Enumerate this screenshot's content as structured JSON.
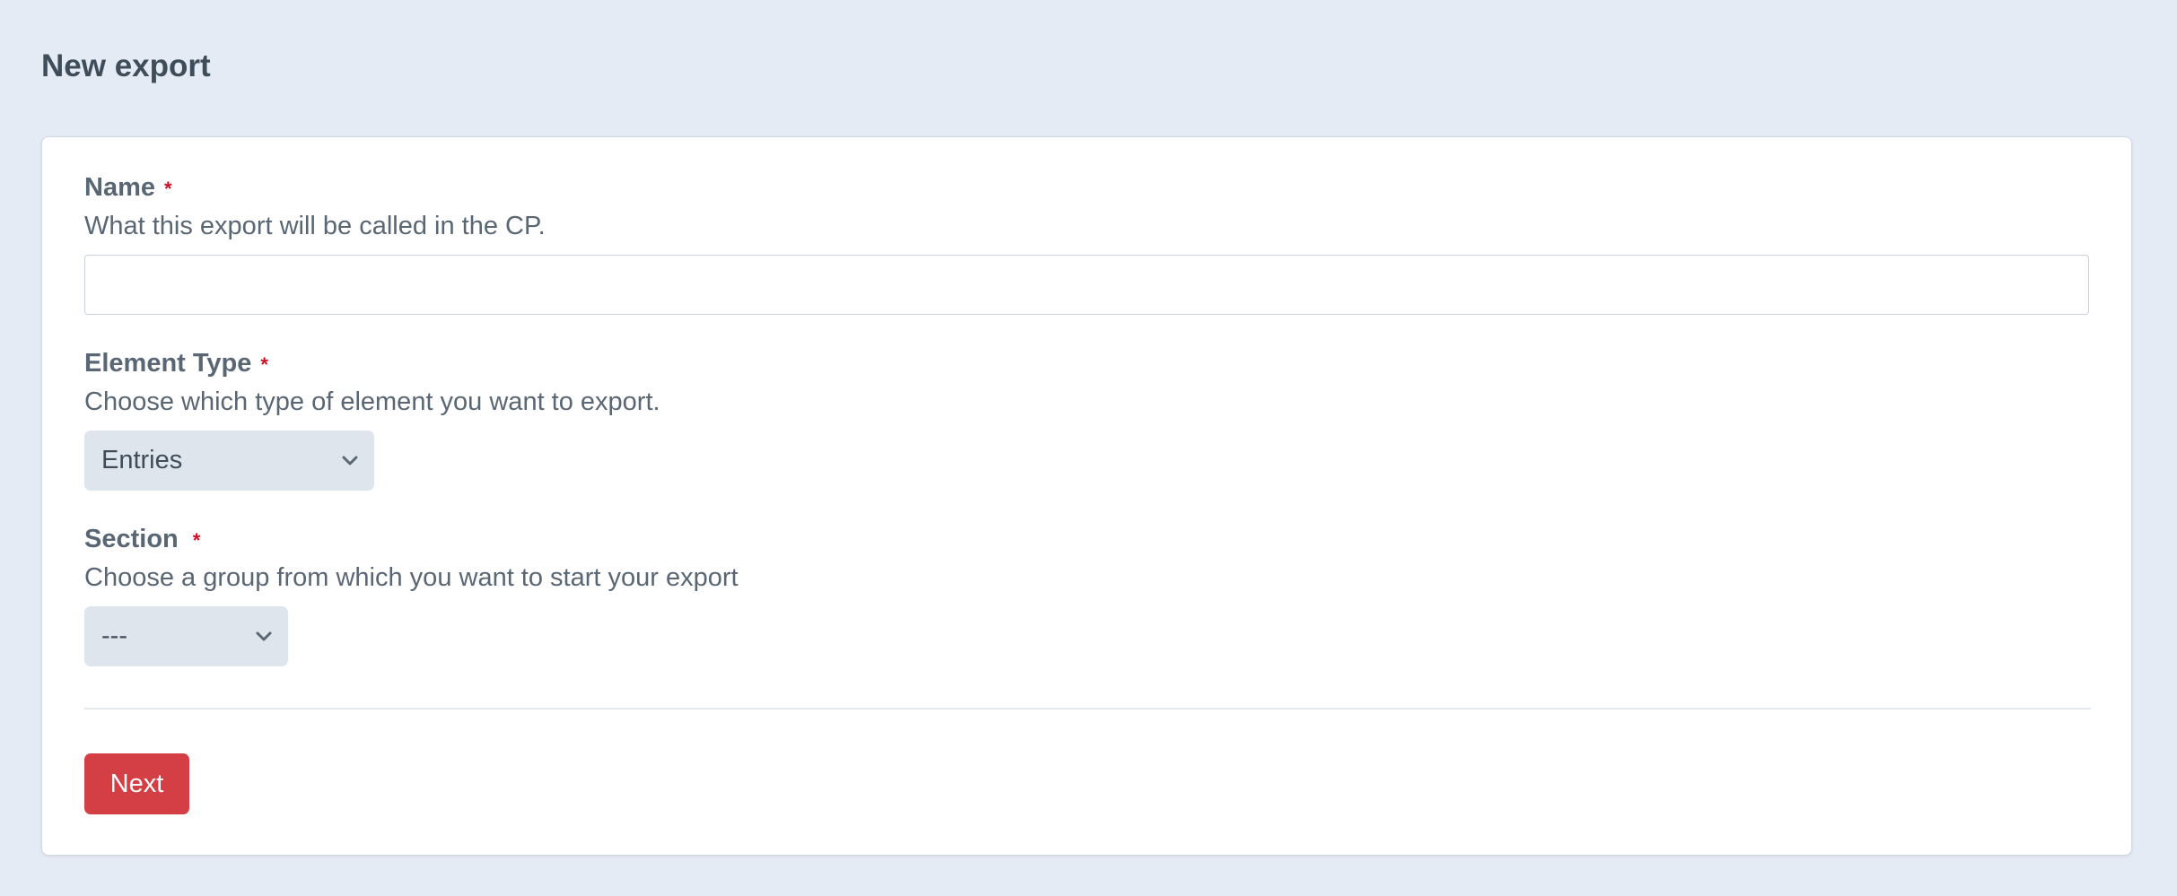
{
  "page": {
    "title": "New export"
  },
  "form": {
    "name_field": {
      "label": "Name",
      "required_marker": "*",
      "instructions": "What this export will be called in the CP.",
      "value": ""
    },
    "element_type_field": {
      "label": "Element Type",
      "required_marker": "*",
      "instructions": "Choose which type of element you want to export.",
      "selected": "Entries"
    },
    "section_field": {
      "label": "Section",
      "required_marker": "*",
      "instructions": "Choose a group from which you want to start your export",
      "selected": "---"
    },
    "next_button_label": "Next"
  },
  "icons": {
    "required": "asterisk-icon",
    "select_arrow": "chevron-down-icon"
  },
  "colors": {
    "background": "#e4ebf4",
    "card": "#ffffff",
    "required": "#cf1124",
    "primary_button": "#d43f45",
    "select_background": "#dfe5ec"
  }
}
